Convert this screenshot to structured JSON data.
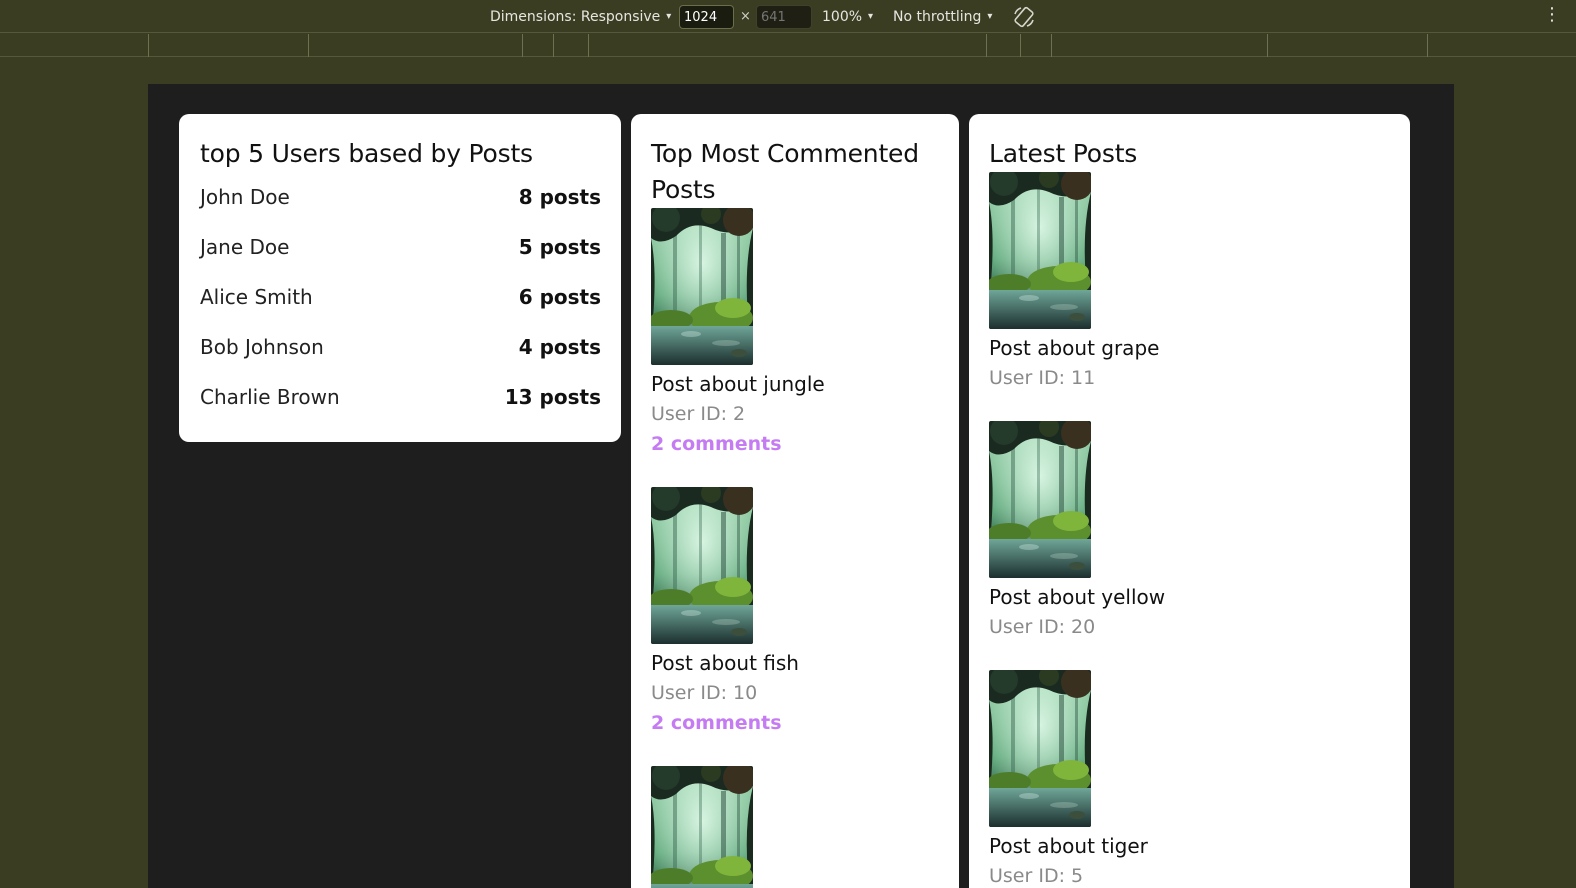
{
  "devtools": {
    "dimensions_label": "Dimensions: Responsive",
    "width_value": "1024",
    "height_placeholder": "641",
    "times_symbol": "×",
    "zoom": "100%",
    "throttling": "No throttling",
    "caret": "▾",
    "more": "⋮"
  },
  "top_users": {
    "title": "top 5 Users based by Posts",
    "users": [
      {
        "name": "John Doe",
        "posts": "8 posts"
      },
      {
        "name": "Jane Doe",
        "posts": "5 posts"
      },
      {
        "name": "Alice Smith",
        "posts": "6 posts"
      },
      {
        "name": "Bob Johnson",
        "posts": "4 posts"
      },
      {
        "name": "Charlie Brown",
        "posts": "13 posts"
      }
    ]
  },
  "most_commented": {
    "title": "Top Most Commented Posts",
    "posts": [
      {
        "title": "Post about jungle",
        "user": "User ID: 2",
        "comments": "2 comments"
      },
      {
        "title": "Post about fish",
        "user": "User ID: 10",
        "comments": "2 comments"
      }
    ]
  },
  "latest": {
    "title": "Latest Posts",
    "posts": [
      {
        "title": "Post about grape",
        "user": "User ID: 11"
      },
      {
        "title": "Post about yellow",
        "user": "User ID: 20"
      },
      {
        "title": "Post about tiger",
        "user": "User ID: 5"
      }
    ]
  },
  "colors": {
    "devtools_bg": "#3b3d23",
    "viewport_bg": "#1e1e1e",
    "comment_accent": "#c57cf3",
    "muted_text": "#8a8a8a"
  },
  "icons": {
    "rotate": "rotate-icon",
    "more": "kebab-menu-icon",
    "thumbnail": "forest-image"
  }
}
